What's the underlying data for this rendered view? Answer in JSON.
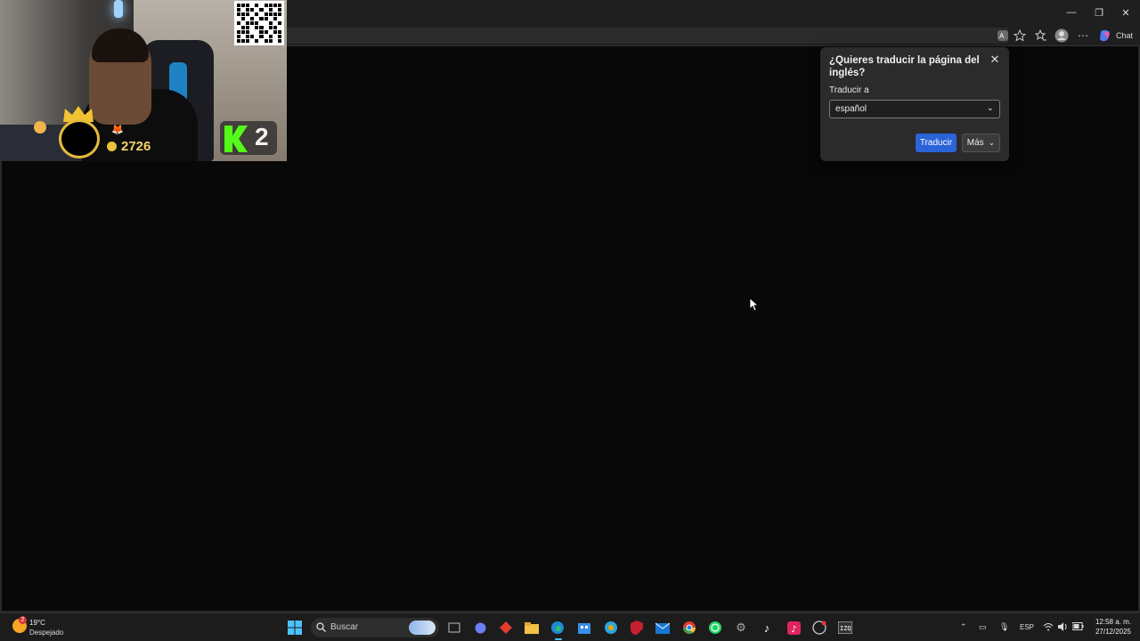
{
  "window": {
    "minimize_glyph": "—",
    "maximize_glyph": "❐",
    "close_glyph": "✕"
  },
  "browser": {
    "chat_label": "Chat"
  },
  "stream_overlay": {
    "points": "2726",
    "kick_count": "2"
  },
  "translate_popup": {
    "title": "¿Quieres traducir la página del inglés?",
    "label": "Traducir a",
    "selected_language": "español",
    "translate_button": "Traducir",
    "more_button": "Más"
  },
  "taskbar": {
    "weather_badge": "2",
    "temperature": "19°C",
    "condition": "Despejado",
    "search_label": "Buscar",
    "language": "ESP",
    "time": "12:58 a. m.",
    "date": "27/12/2025"
  },
  "colors": {
    "accent_blue": "#2b63d8",
    "kick_green": "#53fc18",
    "coin_gold": "#e8c236"
  }
}
